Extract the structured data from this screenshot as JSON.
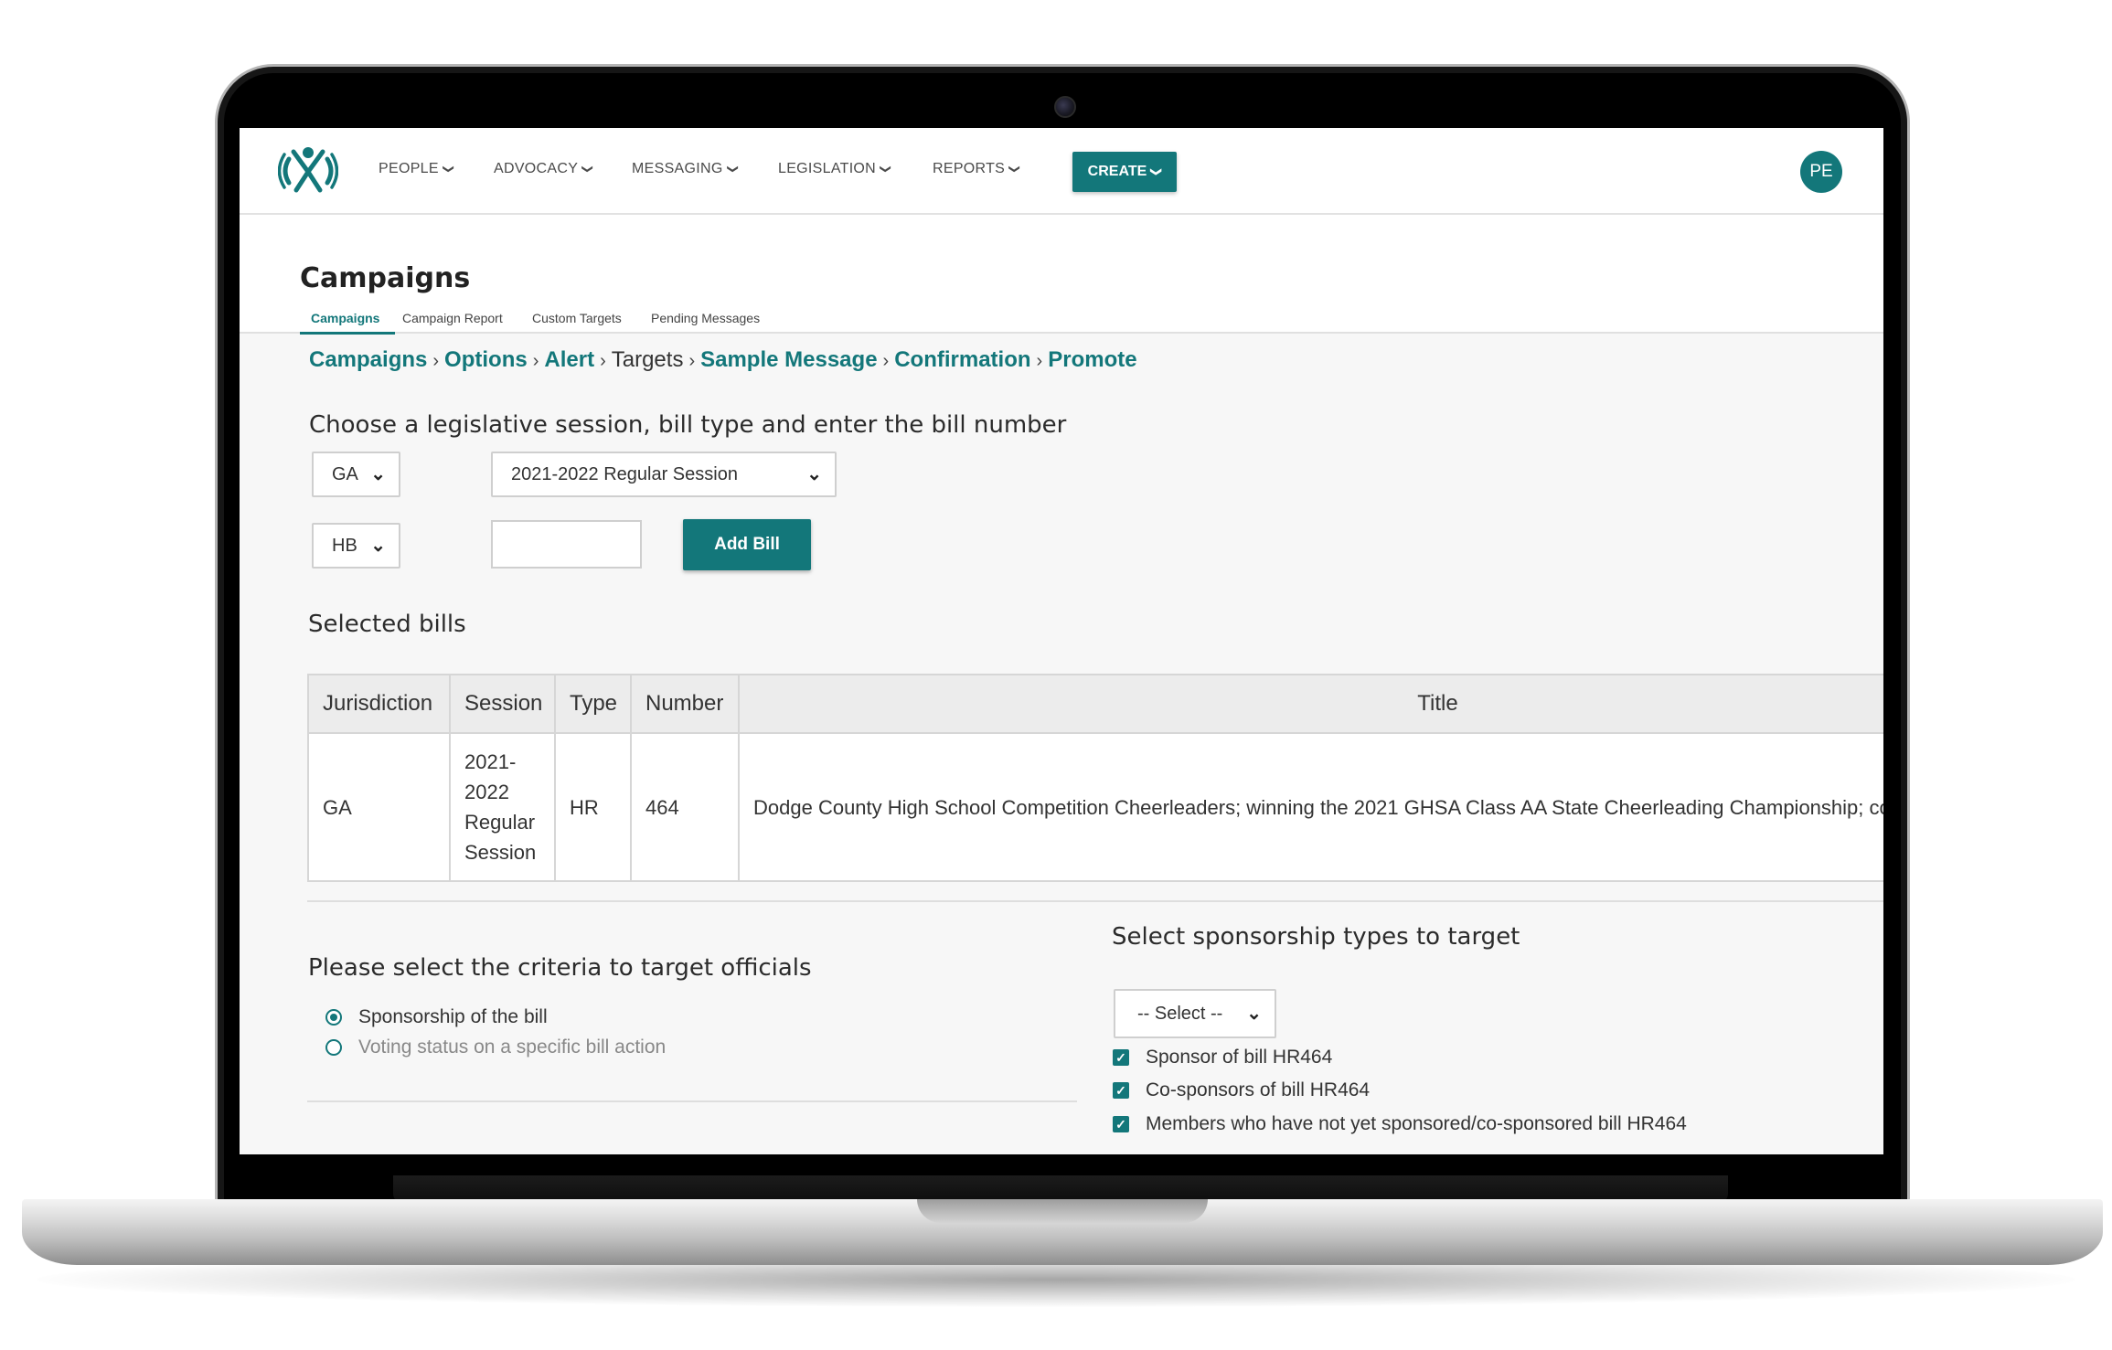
{
  "nav": {
    "items": [
      {
        "label": "PEOPLE"
      },
      {
        "label": "ADVOCACY"
      },
      {
        "label": "MESSAGING"
      },
      {
        "label": "LEGISLATION"
      },
      {
        "label": "REPORTS"
      }
    ],
    "create_label": "CREATE",
    "avatar_initials": "PE",
    "accent_color": "#13777a"
  },
  "page": {
    "title": "Campaigns",
    "subtabs": [
      {
        "label": "Campaigns",
        "active": true
      },
      {
        "label": "Campaign Report"
      },
      {
        "label": "Custom Targets"
      },
      {
        "label": "Pending Messages"
      }
    ]
  },
  "breadcrumb": {
    "steps": [
      {
        "label": "Campaigns",
        "link": true
      },
      {
        "label": "Options",
        "link": true
      },
      {
        "label": "Alert",
        "link": true
      },
      {
        "label": "Targets",
        "link": false
      },
      {
        "label": "Sample Message",
        "link": true
      },
      {
        "label": "Confirmation",
        "link": true
      },
      {
        "label": "Promote",
        "link": true
      }
    ],
    "separator": "›"
  },
  "bill_picker": {
    "heading": "Choose a legislative session, bill type and enter the bill number",
    "state_value": "GA",
    "session_value": "2021-2022 Regular Session",
    "type_value": "HB",
    "number_value": "",
    "add_button_label": "Add Bill"
  },
  "selected_bills": {
    "heading": "Selected bills",
    "columns": [
      "Jurisdiction",
      "Session",
      "Type",
      "Number",
      "Title"
    ],
    "rows": [
      {
        "jurisdiction": "GA",
        "session": "2021-2022 Regular Session",
        "type": "HR",
        "number": "464",
        "title": "Dodge County High School Competition Cheerleaders; winning the 2021 GHSA Class AA State Cheerleading Championship; comme"
      }
    ]
  },
  "criteria": {
    "heading": "Please select the criteria to target officials",
    "options": [
      {
        "label": "Sponsorship of the bill",
        "selected": true
      },
      {
        "label": "Voting status on a specific bill action",
        "selected": false
      }
    ]
  },
  "sponsorship": {
    "heading": "Select sponsorship types to target",
    "select_value": "-- Select --",
    "checks": [
      {
        "label": "Sponsor of bill HR464",
        "checked": true
      },
      {
        "label": "Co-sponsors of bill HR464",
        "checked": true
      },
      {
        "label": "Members who have not yet sponsored/co-sponsored bill HR464",
        "checked": true
      }
    ]
  }
}
